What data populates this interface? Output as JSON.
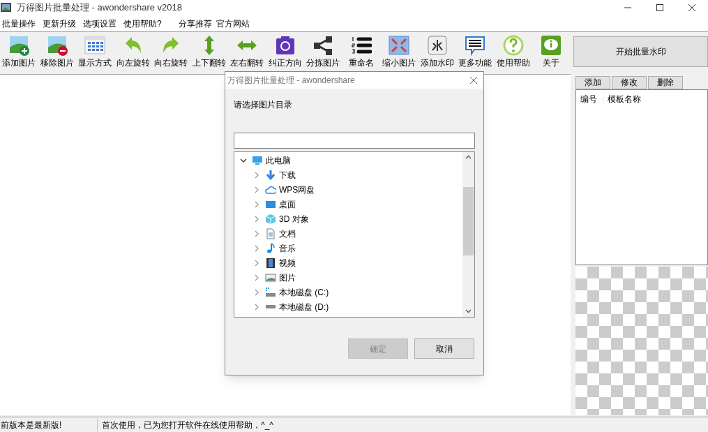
{
  "window": {
    "title": "万得图片批量处理 - awondershare v2018"
  },
  "menu": [
    "批量操作",
    "更新升级",
    "选项设置",
    "使用帮助?",
    "分享推荐",
    "官方网站"
  ],
  "toolbar": [
    {
      "label": "添加图片"
    },
    {
      "label": "移除图片"
    },
    {
      "label": "显示方式"
    },
    {
      "label": "向左旋转"
    },
    {
      "label": "向右旋转"
    },
    {
      "label": "上下翻转"
    },
    {
      "label": "左右翻转"
    },
    {
      "label": "纠正方向"
    },
    {
      "label": "分拣图片"
    },
    {
      "label": "重命名"
    },
    {
      "label": "缩小图片"
    },
    {
      "label": "添加水印"
    },
    {
      "label": "更多功能"
    },
    {
      "label": "使用帮助"
    },
    {
      "label": "关于"
    }
  ],
  "right_panel": {
    "start_button": "开始批量水印",
    "template_buttons": [
      "添加",
      "修改",
      "删除"
    ],
    "template_columns": [
      "编号",
      "模板名称"
    ]
  },
  "dialog": {
    "title": "万得图片批量处理 - awondershare",
    "prompt": "请选择图片目录",
    "tree": {
      "label": "此电脑",
      "expanded": true,
      "children": [
        {
          "label": "下载",
          "expanded": false
        },
        {
          "label": "WPS网盘",
          "expanded": false
        },
        {
          "label": "桌面",
          "expanded": false
        },
        {
          "label": "3D 对象",
          "expanded": false
        },
        {
          "label": "文档",
          "expanded": false
        },
        {
          "label": "音乐",
          "expanded": false
        },
        {
          "label": "视频",
          "expanded": false
        },
        {
          "label": "图片",
          "expanded": false
        },
        {
          "label": "本地磁盘 (C:)",
          "expanded": false
        },
        {
          "label": "本地磁盘 (D:)",
          "expanded": false
        }
      ]
    },
    "buttons": [
      {
        "label": "确定",
        "disabled": true
      },
      {
        "label": "取消",
        "disabled": false
      }
    ]
  },
  "status_bar": [
    "前版本是最新版!",
    "首次使用，已为您打开软件在线使用帮助，^_^"
  ]
}
